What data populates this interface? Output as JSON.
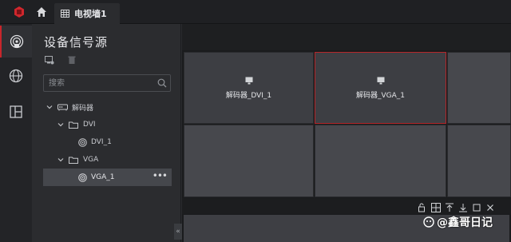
{
  "app": {
    "tab_title": "电视墙1"
  },
  "panel": {
    "title": "设备信号源",
    "search_placeholder": "搜索"
  },
  "tree": {
    "decoder": "解码器",
    "dvi_group": "DVI",
    "dvi_item": "DVI_1",
    "vga_group": "VGA",
    "vga_item": "VGA_1",
    "more": "•••"
  },
  "wall": {
    "cell1_label": "解码器_DVI_1",
    "cell2_label": "解码器_VGA_1"
  },
  "watermark": "@鑫哥日记",
  "colors": {
    "accent": "#c8262b",
    "selection": "#b5262a"
  }
}
